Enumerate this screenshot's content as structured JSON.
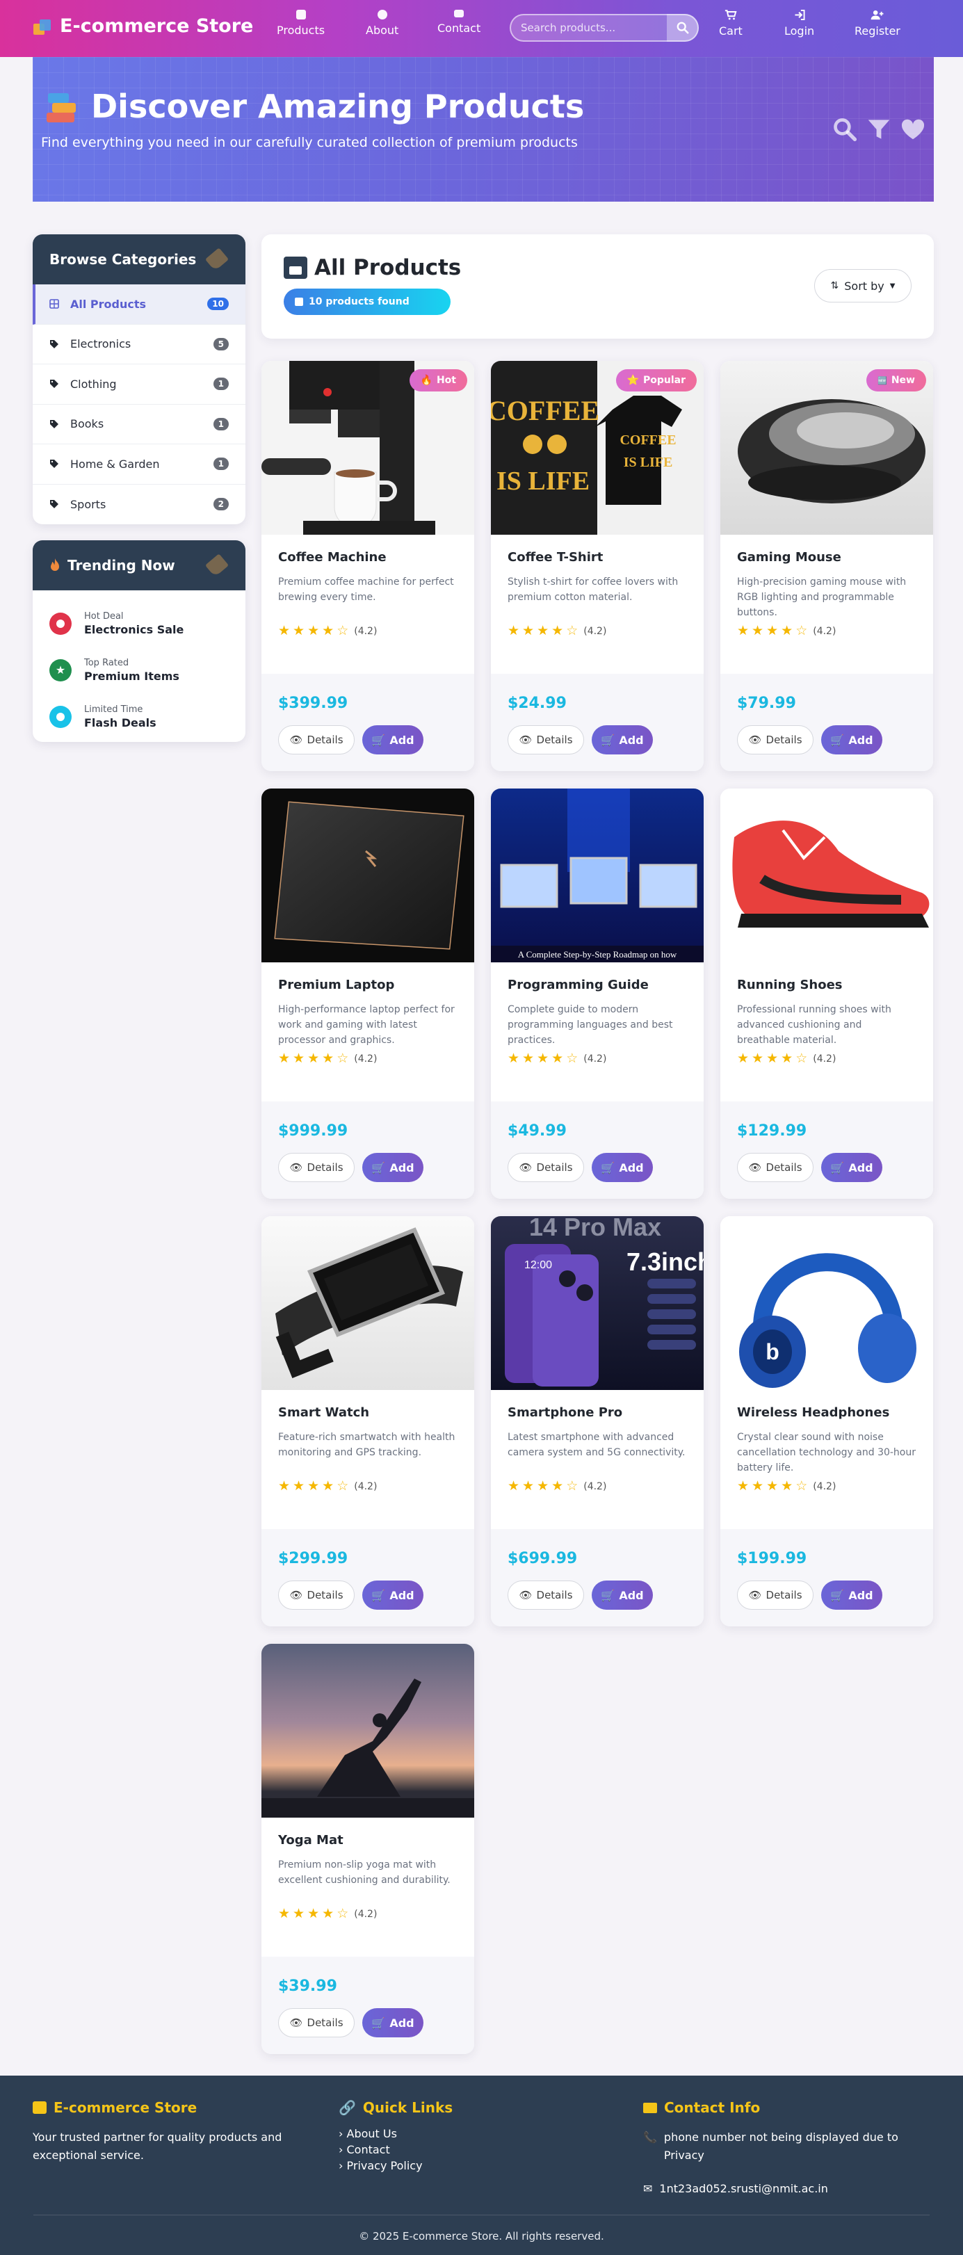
{
  "nav": {
    "brand": "E-commerce Store",
    "links": [
      "Products",
      "About",
      "Contact"
    ],
    "search_placeholder": "Search products...",
    "right_links": [
      "Cart",
      "Login",
      "Register"
    ]
  },
  "hero": {
    "title": "Discover Amazing Products",
    "subtitle": "Find everything you need in our carefully curated collection of premium products"
  },
  "sidebar": {
    "categories_title": "Browse Categories",
    "categories": [
      {
        "label": "All Products",
        "count": "10",
        "active": true
      },
      {
        "label": "Electronics",
        "count": "5"
      },
      {
        "label": "Clothing",
        "count": "1"
      },
      {
        "label": "Books",
        "count": "1"
      },
      {
        "label": "Home & Garden",
        "count": "1"
      },
      {
        "label": "Sports",
        "count": "2"
      }
    ],
    "trending_title": "Trending Now",
    "trending": [
      {
        "small": "Hot Deal",
        "big": "Electronics Sale",
        "color": "#e0334a"
      },
      {
        "small": "Top Rated",
        "big": "Premium Items",
        "color": "#1f8f4e"
      },
      {
        "small": "Limited Time",
        "big": "Flash Deals",
        "color": "#19c2e8"
      }
    ]
  },
  "main": {
    "title": "All Products",
    "found": "10 products found",
    "sort": "Sort by"
  },
  "products": [
    {
      "name": "Coffee Machine",
      "desc": "Premium coffee machine for perfect brewing every time.",
      "rating": "(4.2)",
      "price": "$399.99",
      "badge": "Hot"
    },
    {
      "name": "Coffee T-Shirt",
      "desc": "Stylish t-shirt for coffee lovers with premium cotton material.",
      "rating": "(4.2)",
      "price": "$24.99",
      "badge": "Popular"
    },
    {
      "name": "Gaming Mouse",
      "desc": "High-precision gaming mouse with RGB lighting and programmable buttons.",
      "rating": "(4.2)",
      "price": "$79.99",
      "badge": "New"
    },
    {
      "name": "Premium Laptop",
      "desc": "High-performance laptop perfect for work and gaming with latest processor and graphics.",
      "rating": "(4.2)",
      "price": "$999.99"
    },
    {
      "name": "Programming Guide",
      "desc": "Complete guide to modern programming languages and best practices.",
      "rating": "(4.2)",
      "price": "$49.99"
    },
    {
      "name": "Running Shoes",
      "desc": "Professional running shoes with advanced cushioning and breathable material.",
      "rating": "(4.2)",
      "price": "$129.99"
    },
    {
      "name": "Smart Watch",
      "desc": "Feature-rich smartwatch with health monitoring and GPS tracking.",
      "rating": "(4.2)",
      "price": "$299.99"
    },
    {
      "name": "Smartphone Pro",
      "desc": "Latest smartphone with advanced camera system and 5G connectivity.",
      "rating": "(4.2)",
      "price": "$699.99"
    },
    {
      "name": "Wireless Headphones",
      "desc": "Crystal clear sound with noise cancellation technology and 30-hour battery life.",
      "rating": "(4.2)",
      "price": "$199.99"
    },
    {
      "name": "Yoga Mat",
      "desc": "Premium non-slip yoga mat with excellent cushioning and durability.",
      "rating": "(4.2)",
      "price": "$39.99"
    }
  ],
  "product_images": {
    "shirt_line1": "COFFEE",
    "shirt_line2": "IS LIFE",
    "book_caption": "A Complete Step-by-Step Roadmap on how",
    "phone_banner": "14 Pro Max",
    "phone_size": "7.3inch",
    "phone_time": "12:00"
  },
  "buttons": {
    "details": "Details",
    "add": "Add"
  },
  "footer": {
    "brand": "E-commerce Store",
    "tagline": "Your trusted partner for quality products and exceptional service.",
    "quick_links_title": "Quick Links",
    "quick_links": [
      "About Us",
      "Contact",
      "Privacy Policy"
    ],
    "contact_title": "Contact Info",
    "phone": "phone number not being displayed due to Privacy",
    "email": "1nt23ad052.srusti@nmit.ac.in",
    "copyright": "© 2025 E-commerce Store. All rights reserved."
  }
}
